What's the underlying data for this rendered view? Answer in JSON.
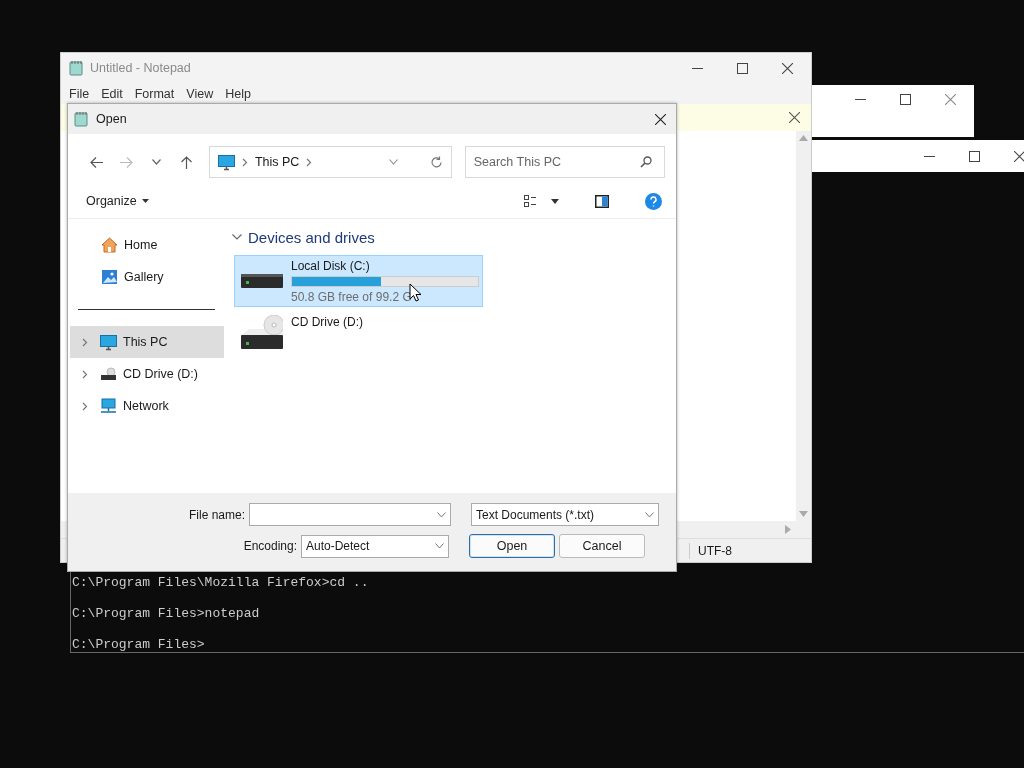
{
  "console": {
    "lines": [
      "C:\\Program Files\\Mozilla Firefox>cd ..",
      "C:\\Program Files>notepad",
      "C:\\Program Files>"
    ]
  },
  "notepad": {
    "title": "Untitled - Notepad",
    "menu": [
      "File",
      "Edit",
      "Format",
      "View",
      "Help"
    ],
    "status_encoding": "UTF-8"
  },
  "dialog": {
    "title": "Open",
    "address": {
      "location": "This PC"
    },
    "search": {
      "placeholder": "Search This PC"
    },
    "toolbar": {
      "organize": "Organize"
    },
    "sidebar": {
      "quick": [
        {
          "label": "Home"
        },
        {
          "label": "Gallery"
        }
      ],
      "tree": [
        {
          "label": "This PC",
          "selected": true
        },
        {
          "label": "CD Drive (D:)",
          "selected": false
        },
        {
          "label": "Network",
          "selected": false
        }
      ]
    },
    "group": {
      "title": "Devices and drives"
    },
    "drives": [
      {
        "kind": "disk",
        "name": "Local Disk (C:)",
        "selected": true,
        "level": 0.48,
        "free": "50.8 GB free of 99.2 G"
      },
      {
        "kind": "cd",
        "name": "CD Drive (D:)",
        "selected": false
      }
    ],
    "file_name": {
      "label": "File name:"
    },
    "file_type": "Text Documents (*.txt)",
    "encoding": {
      "label": "Encoding:",
      "value": "Auto-Detect"
    },
    "buttons": [
      {
        "kind": "primary",
        "label": "Open"
      },
      {
        "kind": "secondary",
        "label": "Cancel"
      }
    ]
  }
}
